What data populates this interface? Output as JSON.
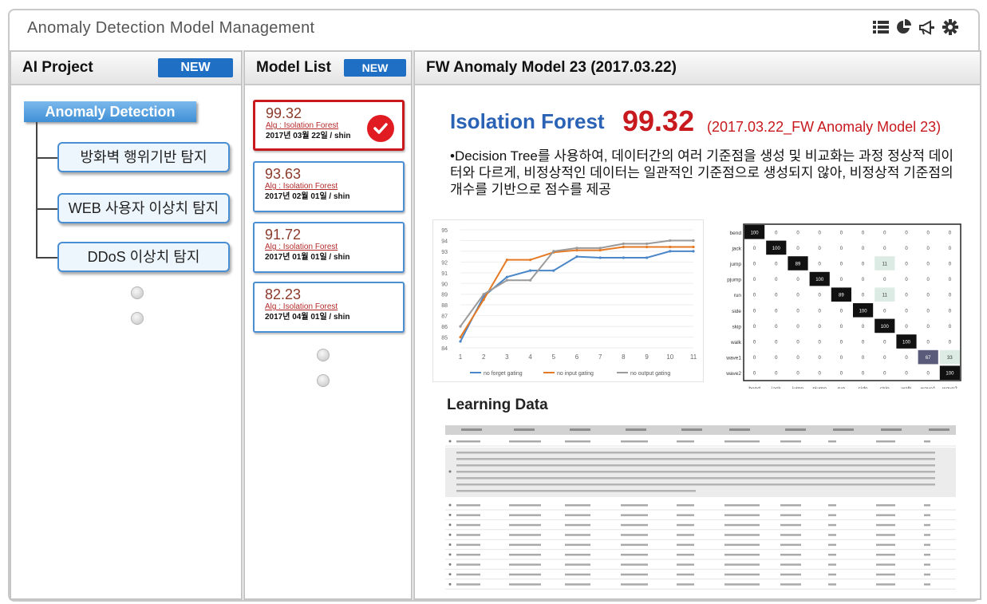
{
  "window": {
    "title": "Anomaly Detection Model Management"
  },
  "toolbar": {
    "icons": [
      "list-icon",
      "pie-chart-icon",
      "megaphone-icon",
      "gear-icon"
    ]
  },
  "project_panel": {
    "header": "AI Project",
    "new_label": "NEW",
    "root": "Anomaly Detection",
    "children": [
      "방화벽 행위기반 탐지",
      "WEB 사용자 이상치 탐지",
      "DDoS 이상치 탐지"
    ]
  },
  "model_panel": {
    "header": "Model List",
    "new_label": "NEW",
    "models": [
      {
        "score": "99.32",
        "alg": "Alg : Isolation Forest",
        "meta": "2017년 03월 22일 / shin",
        "selected": true
      },
      {
        "score": "93.63",
        "alg": "Alg : Isolation Forest",
        "meta": "2017년 02월 01일 / shin",
        "selected": false
      },
      {
        "score": "91.72",
        "alg": "Alg : Isolation Forest",
        "meta": "2017년 01월 01일 / shin",
        "selected": false
      },
      {
        "score": "82.23",
        "alg": "Alg : Isolation Forest",
        "meta": "2017년 04월 01일 / shin",
        "selected": false
      }
    ]
  },
  "detail": {
    "header": "FW Anomaly Model 23 (2017.03.22)",
    "algorithm": "Isolation Forest",
    "score": "99.32",
    "subinfo": "(2017.03.22_FW Anomaly Model 23)",
    "description": "•Decision Tree를 사용하여, 데이터간의 여러 기준점을 생성 및 비교화는 과정 정상적 데이터와 다르게, 비정상적인 데이터는 일관적인 기준점으로 생성되지 않아, 비정상적 기준점의 개수를 기반으로 점수를 제공",
    "learning_title": "Learning Data"
  },
  "chart_data": [
    {
      "type": "line",
      "x": [
        1,
        2,
        3,
        4,
        5,
        6,
        7,
        8,
        9,
        10,
        11
      ],
      "ylim": [
        84,
        95
      ],
      "yticks": [
        84,
        85,
        86,
        87,
        88,
        89,
        90,
        91,
        92,
        93,
        94,
        95
      ],
      "legend_position": "bottom",
      "series": [
        {
          "name": "no forget gating",
          "color": "#4a86c8",
          "values": [
            84.6,
            88.8,
            90.6,
            91.2,
            91.2,
            92.5,
            92.4,
            92.4,
            92.4,
            93.0,
            93.0
          ]
        },
        {
          "name": "no input gating",
          "color": "#e67a24",
          "values": [
            85.0,
            88.5,
            92.2,
            92.2,
            92.9,
            93.1,
            93.1,
            93.4,
            93.4,
            93.4,
            93.4
          ]
        },
        {
          "name": "no output gating",
          "color": "#9a9a9a",
          "values": [
            86.0,
            89.0,
            90.3,
            90.3,
            93.0,
            93.3,
            93.3,
            93.7,
            93.7,
            94.0,
            94.0
          ]
        }
      ]
    },
    {
      "type": "heatmap",
      "rows": [
        "bend",
        "jack",
        "jump",
        "pjump",
        "run",
        "side",
        "skip",
        "walk",
        "wave1",
        "wave2"
      ],
      "cols": [
        "bend",
        "jack",
        "jump",
        "pjump",
        "run",
        "side",
        "skip",
        "walk",
        "wave1",
        "wave2"
      ],
      "values": [
        [
          100,
          0,
          0,
          0,
          0,
          0,
          0,
          0,
          0,
          0
        ],
        [
          0,
          100,
          0,
          0,
          0,
          0,
          0,
          0,
          0,
          0
        ],
        [
          0,
          0,
          89,
          0,
          0,
          0,
          11,
          0,
          0,
          0
        ],
        [
          0,
          0,
          0,
          100,
          0,
          0,
          0,
          0,
          0,
          0
        ],
        [
          0,
          0,
          0,
          0,
          89,
          0,
          11,
          0,
          0,
          0
        ],
        [
          0,
          0,
          0,
          0,
          0,
          100,
          0,
          0,
          0,
          0
        ],
        [
          0,
          0,
          0,
          0,
          0,
          0,
          100,
          0,
          0,
          0
        ],
        [
          0,
          0,
          0,
          0,
          0,
          0,
          0,
          100,
          0,
          0
        ],
        [
          0,
          0,
          0,
          0,
          0,
          0,
          0,
          0,
          67,
          33
        ],
        [
          0,
          0,
          0,
          0,
          0,
          0,
          0,
          0,
          0,
          100
        ]
      ]
    }
  ]
}
